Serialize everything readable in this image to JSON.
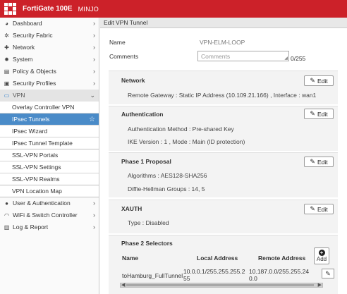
{
  "header": {
    "model": "FortiGate 100E",
    "hostname": "MINJO"
  },
  "sidebar": {
    "items": [
      {
        "label": "Dashboard",
        "icon": "dashboard-icon"
      },
      {
        "label": "Security Fabric",
        "icon": "fabric-icon"
      },
      {
        "label": "Network",
        "icon": "network-icon"
      },
      {
        "label": "System",
        "icon": "gear-icon"
      },
      {
        "label": "Policy & Objects",
        "icon": "policy-icon"
      },
      {
        "label": "Security Profiles",
        "icon": "lock-icon"
      },
      {
        "label": "VPN",
        "icon": "monitor-icon"
      }
    ],
    "vpn_sub": [
      "Overlay Controller VPN",
      "IPsec Tunnels",
      "IPsec Wizard",
      "IPsec Tunnel Template",
      "SSL-VPN Portals",
      "SSL-VPN Settings",
      "SSL-VPN Realms",
      "VPN Location Map"
    ],
    "bottom": [
      {
        "label": "User & Authentication",
        "icon": "user-icon"
      },
      {
        "label": "WiFi & Switch Controller",
        "icon": "wifi-icon"
      },
      {
        "label": "Log & Report",
        "icon": "chart-icon"
      }
    ],
    "star": "☆"
  },
  "main": {
    "title": "Edit VPN Tunnel",
    "name_label": "Name",
    "name_value": "VPN-ELM-LOOP",
    "comments_label": "Comments",
    "comments_placeholder": "Comments",
    "comments_counter": "0/255",
    "edit_label": "Edit",
    "network": {
      "title": "Network",
      "line1": "Remote Gateway : Static IP Address (10.109.21.166) , Interface : wan1"
    },
    "authentication": {
      "title": "Authentication",
      "line1": "Authentication Method : Pre-shared Key",
      "line2": "IKE Version : 1 , Mode : Main (ID protection)"
    },
    "phase1": {
      "title": "Phase 1 Proposal",
      "line1": "Algorithms : AES128-SHA256",
      "line2": "Diffie-Hellman Groups : 14, 5"
    },
    "xauth": {
      "title": "XAUTH",
      "line1": "Type : Disabled"
    },
    "phase2": {
      "title": "Phase 2 Selectors",
      "col_name": "Name",
      "col_local": "Local Address",
      "col_remote": "Remote Address",
      "add_label": "Add",
      "row": {
        "name": "toHamburg_FullTunnel",
        "local_1": "10.0.0.1/255.255.255.2",
        "local_2": "55",
        "remote_1": "10.187.0.0/255.255.24",
        "remote_2": "0.0"
      }
    }
  }
}
